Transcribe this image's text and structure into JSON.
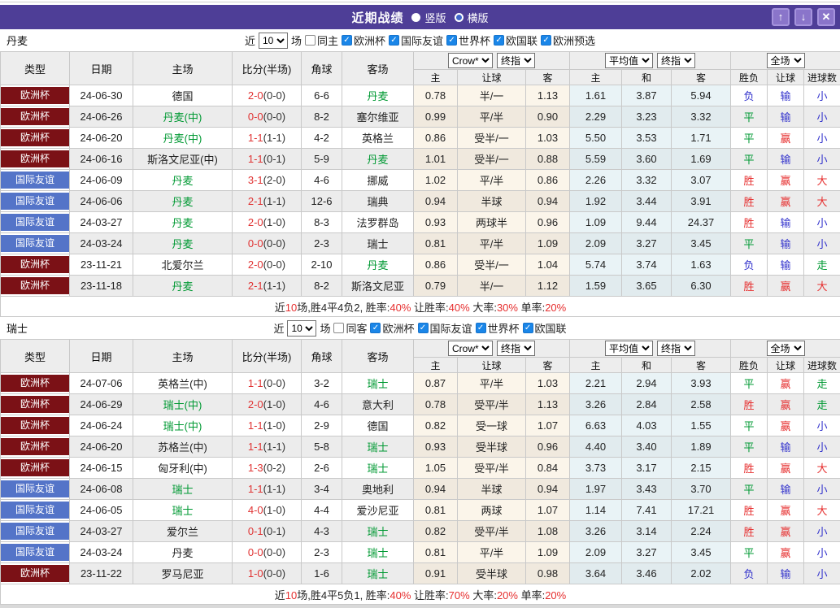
{
  "titlebar": {
    "title": "近期战绩",
    "radio_vertical": "竖版",
    "radio_horizontal": "横版",
    "selected_layout": "横版",
    "up_icon": "↑",
    "down_icon": "↓",
    "close_icon": "✕",
    "bar_color": "#4e3e97",
    "button_color": "#8a75ca"
  },
  "filter_labels": {
    "near": "近",
    "near_value": "10",
    "games": "场"
  },
  "columns": {
    "type": "类型",
    "date": "日期",
    "home": "主场",
    "score": "比分(半场)",
    "corners": "角球",
    "away": "客场",
    "dd_crow": "Crow*",
    "dd_final1": "终指",
    "dd_avg": "平均值",
    "dd_final2": "终指",
    "dd_full": "全场",
    "sub_crow_home": "主",
    "sub_crow_handicap": "让球",
    "sub_crow_away": "客",
    "sub_avg_home": "主",
    "sub_avg_draw": "和",
    "sub_avg_away": "客",
    "sub_wdl": "胜负",
    "sub_handicap": "让球",
    "sub_goals": "进球数"
  },
  "type_colors": {
    "欧洲杯": "#7b1116",
    "国际友谊": "#5474c8"
  },
  "result_colors": {
    "胜": "#e62f2f",
    "平": "#009933",
    "负": "#3333cc",
    "赢": "#e62f2f",
    "输": "#3333cc",
    "走": "#009933",
    "大": "#e62f2f",
    "小": "#3333cc"
  },
  "highlight_color": "#009933",
  "score_color": "#e03333",
  "sections": [
    {
      "team": "丹麦",
      "same_label": "同主",
      "same_checked": false,
      "competitions": [
        "欧洲杯",
        "国际友谊",
        "世界杯",
        "欧国联",
        "欧洲预选"
      ],
      "rows": [
        {
          "type": "欧洲杯",
          "date": "24-06-30",
          "home": "德国",
          "home_hl": false,
          "score": "2-0",
          "half": "(0-0)",
          "corners": "6-6",
          "away": "丹麦",
          "away_hl": true,
          "crow": [
            "0.78",
            "半/一",
            "1.13"
          ],
          "avg": [
            "1.61",
            "3.87",
            "5.94"
          ],
          "results": [
            "负",
            "输",
            "小"
          ]
        },
        {
          "type": "欧洲杯",
          "date": "24-06-26",
          "home": "丹麦(中)",
          "home_hl": true,
          "score": "0-0",
          "half": "(0-0)",
          "corners": "8-2",
          "away": "塞尔维亚",
          "away_hl": false,
          "crow": [
            "0.99",
            "平/半",
            "0.90"
          ],
          "avg": [
            "2.29",
            "3.23",
            "3.32"
          ],
          "results": [
            "平",
            "输",
            "小"
          ]
        },
        {
          "type": "欧洲杯",
          "date": "24-06-20",
          "home": "丹麦(中)",
          "home_hl": true,
          "score": "1-1",
          "half": "(1-1)",
          "corners": "4-2",
          "away": "英格兰",
          "away_hl": false,
          "crow": [
            "0.86",
            "受半/一",
            "1.03"
          ],
          "avg": [
            "5.50",
            "3.53",
            "1.71"
          ],
          "results": [
            "平",
            "赢",
            "小"
          ]
        },
        {
          "type": "欧洲杯",
          "date": "24-06-16",
          "home": "斯洛文尼亚(中)",
          "home_hl": false,
          "score": "1-1",
          "half": "(0-1)",
          "corners": "5-9",
          "away": "丹麦",
          "away_hl": true,
          "crow": [
            "1.01",
            "受半/一",
            "0.88"
          ],
          "avg": [
            "5.59",
            "3.60",
            "1.69"
          ],
          "results": [
            "平",
            "输",
            "小"
          ]
        },
        {
          "type": "国际友谊",
          "date": "24-06-09",
          "home": "丹麦",
          "home_hl": true,
          "score": "3-1",
          "half": "(2-0)",
          "corners": "4-6",
          "away": "挪威",
          "away_hl": false,
          "crow": [
            "1.02",
            "平/半",
            "0.86"
          ],
          "avg": [
            "2.26",
            "3.32",
            "3.07"
          ],
          "results": [
            "胜",
            "赢",
            "大"
          ]
        },
        {
          "type": "国际友谊",
          "date": "24-06-06",
          "home": "丹麦",
          "home_hl": true,
          "score": "2-1",
          "half": "(1-1)",
          "corners": "12-6",
          "away": "瑞典",
          "away_hl": false,
          "crow": [
            "0.94",
            "半球",
            "0.94"
          ],
          "avg": [
            "1.92",
            "3.44",
            "3.91"
          ],
          "results": [
            "胜",
            "赢",
            "大"
          ]
        },
        {
          "type": "国际友谊",
          "date": "24-03-27",
          "home": "丹麦",
          "home_hl": true,
          "score": "2-0",
          "half": "(1-0)",
          "corners": "8-3",
          "away": "法罗群岛",
          "away_hl": false,
          "crow": [
            "0.93",
            "两球半",
            "0.96"
          ],
          "avg": [
            "1.09",
            "9.44",
            "24.37"
          ],
          "results": [
            "胜",
            "输",
            "小"
          ]
        },
        {
          "type": "国际友谊",
          "date": "24-03-24",
          "home": "丹麦",
          "home_hl": true,
          "score": "0-0",
          "half": "(0-0)",
          "corners": "2-3",
          "away": "瑞士",
          "away_hl": false,
          "crow": [
            "0.81",
            "平/半",
            "1.09"
          ],
          "avg": [
            "2.09",
            "3.27",
            "3.45"
          ],
          "results": [
            "平",
            "输",
            "小"
          ]
        },
        {
          "type": "欧洲杯",
          "date": "23-11-21",
          "home": "北爱尔兰",
          "home_hl": false,
          "score": "2-0",
          "half": "(0-0)",
          "corners": "2-10",
          "away": "丹麦",
          "away_hl": true,
          "crow": [
            "0.86",
            "受半/一",
            "1.04"
          ],
          "avg": [
            "5.74",
            "3.74",
            "1.63"
          ],
          "results": [
            "负",
            "输",
            "走"
          ]
        },
        {
          "type": "欧洲杯",
          "date": "23-11-18",
          "home": "丹麦",
          "home_hl": true,
          "score": "2-1",
          "half": "(1-1)",
          "corners": "8-2",
          "away": "斯洛文尼亚",
          "away_hl": false,
          "crow": [
            "0.79",
            "半/一",
            "1.12"
          ],
          "avg": [
            "1.59",
            "3.65",
            "6.30"
          ],
          "results": [
            "胜",
            "赢",
            "大"
          ]
        }
      ],
      "summary": [
        [
          "近",
          "k"
        ],
        [
          "10",
          "r"
        ],
        [
          "场,胜4平4负2, 胜率:",
          "k"
        ],
        [
          "40%",
          "r"
        ],
        [
          " 让胜率:",
          "k"
        ],
        [
          "40%",
          "r"
        ],
        [
          " 大率:",
          "k"
        ],
        [
          "30%",
          "r"
        ],
        [
          " 单率:",
          "k"
        ],
        [
          "20%",
          "r"
        ]
      ]
    },
    {
      "team": "瑞士",
      "same_label": "同客",
      "same_checked": false,
      "competitions": [
        "欧洲杯",
        "国际友谊",
        "世界杯",
        "欧国联"
      ],
      "rows": [
        {
          "type": "欧洲杯",
          "date": "24-07-06",
          "home": "英格兰(中)",
          "home_hl": false,
          "score": "1-1",
          "half": "(0-0)",
          "corners": "3-2",
          "away": "瑞士",
          "away_hl": true,
          "crow": [
            "0.87",
            "平/半",
            "1.03"
          ],
          "avg": [
            "2.21",
            "2.94",
            "3.93"
          ],
          "results": [
            "平",
            "赢",
            "走"
          ]
        },
        {
          "type": "欧洲杯",
          "date": "24-06-29",
          "home": "瑞士(中)",
          "home_hl": true,
          "score": "2-0",
          "half": "(1-0)",
          "corners": "4-6",
          "away": "意大利",
          "away_hl": false,
          "crow": [
            "0.78",
            "受平/半",
            "1.13"
          ],
          "avg": [
            "3.26",
            "2.84",
            "2.58"
          ],
          "results": [
            "胜",
            "赢",
            "走"
          ]
        },
        {
          "type": "欧洲杯",
          "date": "24-06-24",
          "home": "瑞士(中)",
          "home_hl": true,
          "score": "1-1",
          "half": "(1-0)",
          "corners": "2-9",
          "away": "德国",
          "away_hl": false,
          "crow": [
            "0.82",
            "受一球",
            "1.07"
          ],
          "avg": [
            "6.63",
            "4.03",
            "1.55"
          ],
          "results": [
            "平",
            "赢",
            "小"
          ]
        },
        {
          "type": "欧洲杯",
          "date": "24-06-20",
          "home": "苏格兰(中)",
          "home_hl": false,
          "score": "1-1",
          "half": "(1-1)",
          "corners": "5-8",
          "away": "瑞士",
          "away_hl": true,
          "crow": [
            "0.93",
            "受半球",
            "0.96"
          ],
          "avg": [
            "4.40",
            "3.40",
            "1.89"
          ],
          "results": [
            "平",
            "输",
            "小"
          ]
        },
        {
          "type": "欧洲杯",
          "date": "24-06-15",
          "home": "匈牙利(中)",
          "home_hl": false,
          "score": "1-3",
          "half": "(0-2)",
          "corners": "2-6",
          "away": "瑞士",
          "away_hl": true,
          "crow": [
            "1.05",
            "受平/半",
            "0.84"
          ],
          "avg": [
            "3.73",
            "3.17",
            "2.15"
          ],
          "results": [
            "胜",
            "赢",
            "大"
          ]
        },
        {
          "type": "国际友谊",
          "date": "24-06-08",
          "home": "瑞士",
          "home_hl": true,
          "score": "1-1",
          "half": "(1-1)",
          "corners": "3-4",
          "away": "奥地利",
          "away_hl": false,
          "crow": [
            "0.94",
            "半球",
            "0.94"
          ],
          "avg": [
            "1.97",
            "3.43",
            "3.70"
          ],
          "results": [
            "平",
            "输",
            "小"
          ]
        },
        {
          "type": "国际友谊",
          "date": "24-06-05",
          "home": "瑞士",
          "home_hl": true,
          "score": "4-0",
          "half": "(1-0)",
          "corners": "4-4",
          "away": "爱沙尼亚",
          "away_hl": false,
          "crow": [
            "0.81",
            "两球",
            "1.07"
          ],
          "avg": [
            "1.14",
            "7.41",
            "17.21"
          ],
          "results": [
            "胜",
            "赢",
            "大"
          ]
        },
        {
          "type": "国际友谊",
          "date": "24-03-27",
          "home": "爱尔兰",
          "home_hl": false,
          "score": "0-1",
          "half": "(0-1)",
          "corners": "4-3",
          "away": "瑞士",
          "away_hl": true,
          "crow": [
            "0.82",
            "受平/半",
            "1.08"
          ],
          "avg": [
            "3.26",
            "3.14",
            "2.24"
          ],
          "results": [
            "胜",
            "赢",
            "小"
          ]
        },
        {
          "type": "国际友谊",
          "date": "24-03-24",
          "home": "丹麦",
          "home_hl": false,
          "score": "0-0",
          "half": "(0-0)",
          "corners": "2-3",
          "away": "瑞士",
          "away_hl": true,
          "crow": [
            "0.81",
            "平/半",
            "1.09"
          ],
          "avg": [
            "2.09",
            "3.27",
            "3.45"
          ],
          "results": [
            "平",
            "赢",
            "小"
          ]
        },
        {
          "type": "欧洲杯",
          "date": "23-11-22",
          "home": "罗马尼亚",
          "home_hl": false,
          "score": "1-0",
          "half": "(0-0)",
          "corners": "1-6",
          "away": "瑞士",
          "away_hl": true,
          "crow": [
            "0.91",
            "受半球",
            "0.98"
          ],
          "avg": [
            "3.64",
            "3.46",
            "2.02"
          ],
          "results": [
            "负",
            "输",
            "小"
          ]
        }
      ],
      "summary": [
        [
          "近",
          "k"
        ],
        [
          "10",
          "r"
        ],
        [
          "场,胜4平5负1, 胜率:",
          "k"
        ],
        [
          "40%",
          "r"
        ],
        [
          " 让胜率:",
          "k"
        ],
        [
          "70%",
          "r"
        ],
        [
          " 大率:",
          "k"
        ],
        [
          "20%",
          "r"
        ],
        [
          " 单率:",
          "k"
        ],
        [
          "20%",
          "r"
        ]
      ]
    }
  ]
}
